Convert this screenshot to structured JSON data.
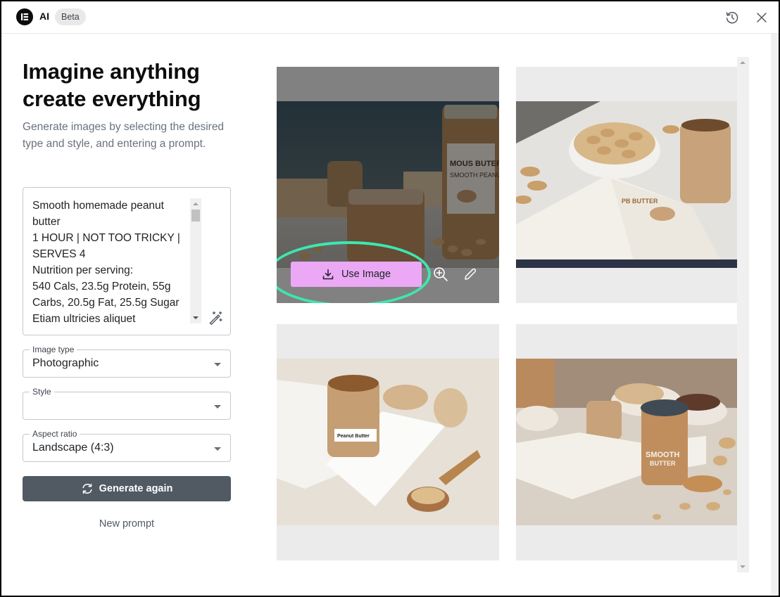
{
  "header": {
    "logo_icon": "elementor-logo-icon",
    "app_title": "AI",
    "badge": "Beta",
    "history_icon": "history-icon",
    "close_icon": "close-icon"
  },
  "left_panel": {
    "title_line1": "Imagine anything",
    "title_line2": "create everything",
    "subtitle": "Generate images by selecting the desired type and style, and entering a prompt.",
    "prompt_value": "Smooth homemade peanut butter\n1 HOUR | NOT TOO TRICKY | SERVES 4\nNutrition per serving:\n540 Cals, 23.5g Protein, 55g Carbs, 20.5g Fat, 25.5g Sugar\nEtiam ultricies aliquet",
    "enhance_icon": "magic-wand-icon",
    "fields": {
      "image_type": {
        "label": "Image type",
        "value": "Photographic"
      },
      "style": {
        "label": "Style",
        "value": ""
      },
      "aspect_ratio": {
        "label": "Aspect ratio",
        "value": "Landscape (4:3)"
      }
    },
    "generate_button": "Generate again",
    "generate_icon": "refresh-icon",
    "new_prompt": "New prompt"
  },
  "results": {
    "images": [
      {
        "description": "Peanut butter jars with clip-top jar and labeled 'MOUS BUTER' jar on table",
        "hovered": true
      },
      {
        "description": "Open recipe book with peanut butter, bowl of peanuts and jar"
      },
      {
        "description": "Jar labeled 'Peanut Butter' on open book with wooden spoon of peanuts"
      },
      {
        "description": "Jar labeled 'SMOOTH BUTTER' with open book and scattered peanuts"
      }
    ],
    "hover_actions": {
      "use_image": "Use Image",
      "use_icon": "download-icon",
      "zoom_icon": "zoom-in-icon",
      "edit_icon": "pencil-icon"
    }
  },
  "colors": {
    "use_button": "#eba8f4",
    "generate_button": "#515962",
    "highlight": "#3ee6b0"
  }
}
